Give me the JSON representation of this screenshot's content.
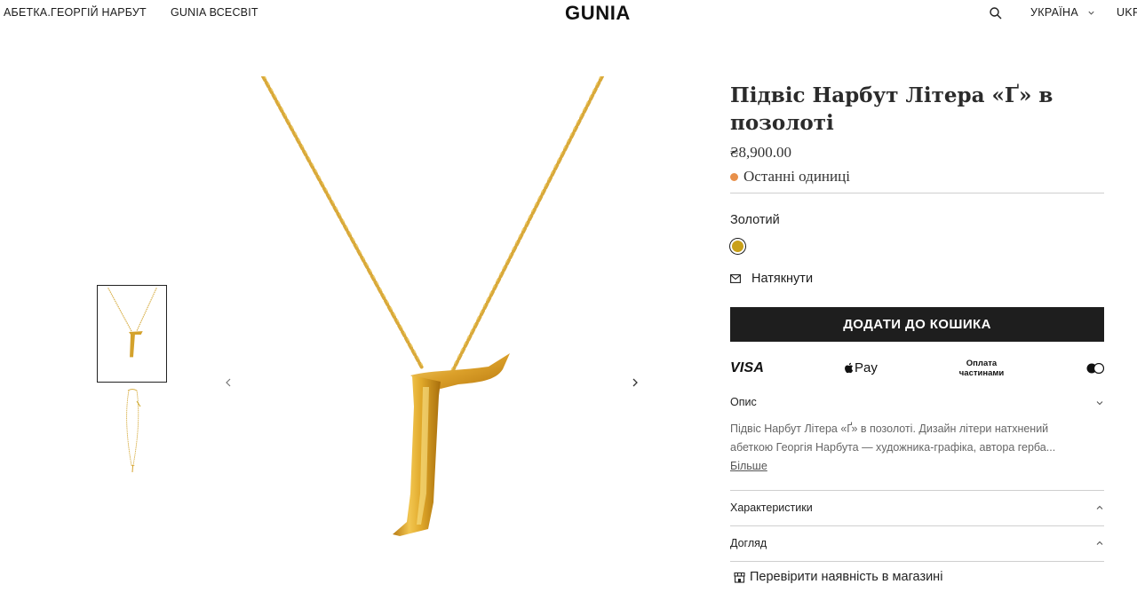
{
  "header": {
    "nav_left": [
      "АБЕТКА.ГЕОРГІЙ НАРБУТ",
      "GUNIA ВСЕСВІТ"
    ],
    "logo": "GUNIA",
    "region": "УКРАЇНА",
    "language": "UKR",
    "icons": {
      "search": "search-icon",
      "region_dropdown": "chevron-down-icon"
    }
  },
  "gallery": {
    "thumbnail_count": 2,
    "active_thumbnail": 1,
    "icons": {
      "prev": "chevron-left-icon",
      "next": "chevron-right-icon"
    }
  },
  "product": {
    "title": "Підвіс Нарбут Літера «Ґ» в позолоті",
    "price": "₴8,900.00",
    "stock_status": "Останні одиниці",
    "stock_color": "#e8904a",
    "color_label": "Золотий",
    "color_swatch": "#c9a018",
    "notify_label": "Натякнути",
    "add_to_cart": "ДОДАТИ ДО КОШИКА",
    "button_color": "#1e1e1e"
  },
  "payment": {
    "visa": "VISA",
    "apple_pay": "Pay",
    "installments": "Оплата частинами",
    "icons": [
      "visa-icon",
      "apple-pay-icon",
      "installments-icon",
      "mastercard-icon"
    ]
  },
  "accordion": {
    "description": {
      "title": "Опис",
      "text": "Підвіс Нарбут Літера «Ґ» в позолоті. Дизайн літери натхнений абеткою Георгія Нарбута — художника-графіка, автора герба...",
      "more": "Більше"
    },
    "characteristics": {
      "title": "Характеристики"
    },
    "care": {
      "title": "Догляд"
    }
  },
  "store_check": "Перевірити наявність в магазині"
}
